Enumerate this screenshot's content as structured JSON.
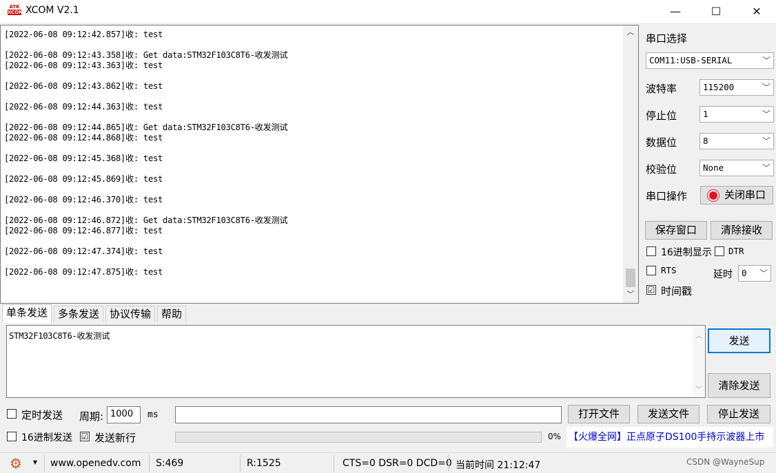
{
  "window": {
    "title": "XCOM V2.1",
    "icon_text_top": "ATK",
    "icon_text_bottom": "XCOM",
    "minimize": "—",
    "maximize": "☐",
    "close": "✕"
  },
  "receive": {
    "lines": [
      "[2022-06-08 09:12:42.857]收: test",
      "",
      "[2022-06-08 09:12:43.358]收: Get data:STM32F103C8T6-收发测试",
      "[2022-06-08 09:12:43.363]收: test",
      "",
      "[2022-06-08 09:12:43.862]收: test",
      "",
      "[2022-06-08 09:12:44.363]收: test",
      "",
      "[2022-06-08 09:12:44.865]收: Get data:STM32F103C8T6-收发测试",
      "[2022-06-08 09:12:44.868]收: test",
      "",
      "[2022-06-08 09:12:45.368]收: test",
      "",
      "[2022-06-08 09:12:45.869]收: test",
      "",
      "[2022-06-08 09:12:46.370]收: test",
      "",
      "[2022-06-08 09:12:46.872]收: Get data:STM32F103C8T6-收发测试",
      "[2022-06-08 09:12:46.877]收: test",
      "",
      "[2022-06-08 09:12:47.374]收: test",
      "",
      "[2022-06-08 09:12:47.875]收: test"
    ]
  },
  "serial": {
    "port_label": "串口选择",
    "port_value": "COM11:USB-SERIAL",
    "baud_label": "波特率",
    "baud_value": "115200",
    "stop_label": "停止位",
    "stop_value": "1",
    "data_label": "数据位",
    "data_value": "8",
    "parity_label": "校验位",
    "parity_value": "None",
    "op_label": "串口操作",
    "op_button": "关闭串口",
    "op_status_color": "#e81123",
    "save_window": "保存窗口",
    "clear_receive": "清除接收",
    "hex_display": "16进制显示",
    "dtr": "DTR",
    "rts": "RTS",
    "delay_label": "延时",
    "delay_value": "0",
    "timestamp": "时间戳",
    "timestamp_checked": "☑"
  },
  "tabs": [
    "单条发送",
    "多条发送",
    "协议传输",
    "帮助"
  ],
  "send": {
    "text": "STM32F103C8T6-收发测试",
    "send_button": "发送",
    "clear_send": "清除发送",
    "timed_send": "定时发送",
    "period_label": "周期:",
    "period_value": "1000",
    "period_unit": "ms",
    "open_file": "打开文件",
    "send_file": "发送文件",
    "stop_send": "停止发送",
    "hex_send": "16进制发送",
    "send_newline": "发送新行",
    "send_newline_checked": "☑",
    "progress": "0%",
    "ad_text": "【火爆全网】正点原子DS100手持示波器上市"
  },
  "status": {
    "gear_icon": "⚙",
    "dropdown": "▾",
    "url": "www.openedv.com",
    "sent": "S:469",
    "received": "R:1525",
    "lines": "CTS=0 DSR=0 DCD=0",
    "time": "当前时间 21:12:47",
    "watermark": "CSDN @WayneSup"
  },
  "colors": {
    "accent": "#0078d7",
    "ad_text": "#0000cc"
  }
}
